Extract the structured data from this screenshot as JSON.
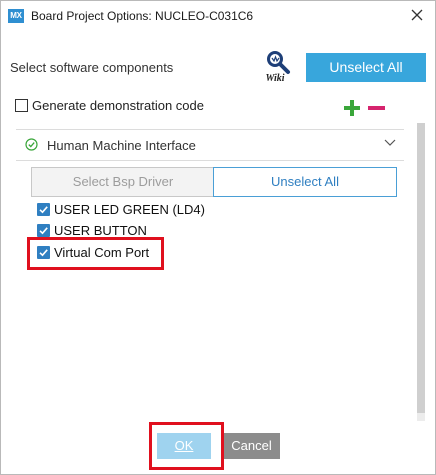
{
  "window": {
    "app_logo": "MX",
    "title": "Board Project Options: NUCLEO-C031C6",
    "close_icon": "close-icon"
  },
  "header": {
    "select_label": "Select software components",
    "wiki_label": "Wiki",
    "unselect_all_label": "Unselect All"
  },
  "demo": {
    "label": "Generate demonstration code",
    "checked": false
  },
  "section": {
    "title": "Human Machine Interface",
    "status_icon": "check-circle-icon",
    "expand_icon": "chevron-down-icon"
  },
  "buttons": {
    "select_bsp": "Select Bsp Driver",
    "unselect_all": "Unselect All"
  },
  "components": [
    {
      "label": "USER LED GREEN (LD4)",
      "checked": true
    },
    {
      "label": "USER BUTTON",
      "checked": true
    },
    {
      "label": "Virtual Com Port",
      "checked": true
    }
  ],
  "footer": {
    "ok": "OK",
    "cancel": "Cancel"
  },
  "colors": {
    "accent_blue": "#38a6dc",
    "checkbox_blue": "#2f7fc1",
    "plus_green": "#3aa63a",
    "minus_pink": "#d6246e",
    "highlight_red": "#e0101e"
  }
}
